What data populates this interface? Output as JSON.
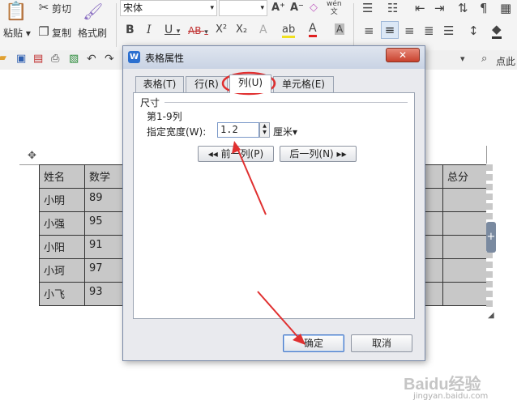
{
  "ribbon": {
    "paste_label": "粘贴",
    "cut_label": "剪切",
    "copy_label": "复制",
    "format_painter_label": "格式刷",
    "font_name": "宋体",
    "font_size": "",
    "bold": "B",
    "italic": "I",
    "underline": "U",
    "strikethrough": "AB",
    "superscript": "X²",
    "subscript": "X₂",
    "font_grow": "A⁺",
    "font_shrink": "A⁻",
    "clear_format": "◇",
    "phonetic": "wén\n文",
    "shade_char": "A",
    "right_find_label": "点此"
  },
  "document": {
    "left_table": [
      [
        "姓名",
        "数学",
        ""
      ],
      [
        "小明",
        "89",
        ""
      ],
      [
        "小强",
        "95",
        ""
      ],
      [
        "小阳",
        "91",
        ""
      ],
      [
        "小珂",
        "97",
        ""
      ],
      [
        "小飞",
        "93",
        ""
      ]
    ],
    "right_table": [
      [
        "",
        "总分"
      ],
      [
        "",
        ""
      ],
      [
        "",
        ""
      ],
      [
        "",
        ""
      ],
      [
        "",
        ""
      ],
      [
        "",
        ""
      ]
    ]
  },
  "dialog": {
    "title": "表格属性",
    "tabs": [
      {
        "label": "表格(T)"
      },
      {
        "label": "行(R)"
      },
      {
        "label": "列(U)"
      },
      {
        "label": "单元格(E)"
      }
    ],
    "section_label": "尺寸",
    "column_range": "第1-9列",
    "width_label": "指定宽度(W):",
    "width_value": "1.2",
    "unit_label": "厘米▾",
    "prev_column": "◂◂ 前一列(P)",
    "next_column": "后一列(N) ▸▸",
    "ok_label": "确定",
    "cancel_label": "取消"
  },
  "watermark": {
    "brand": "Baidu经验",
    "url": "jingyan.baidu.com"
  },
  "colors": {
    "annotation_red": "#e03030",
    "tab_active": "#ffffff",
    "cell_gray": "#c8c8c8",
    "titlebar": "#c9d3e4"
  }
}
